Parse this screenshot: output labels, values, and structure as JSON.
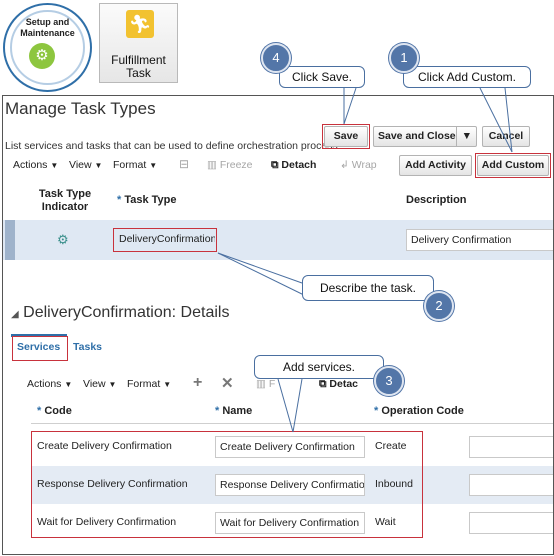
{
  "icons": {
    "setup": {
      "label_line1": "Setup and",
      "label_line2": "Maintenance",
      "icon": "gear-icon"
    },
    "fulfillment": {
      "label_line1": "Fulfillment",
      "label_line2": "Task",
      "icon": "runner-icon"
    }
  },
  "callouts": {
    "c1": {
      "number": "1",
      "text": "Click Add Custom."
    },
    "c2": {
      "number": "2",
      "text": "Describe the task."
    },
    "c3": {
      "number": "3",
      "text": "Add services."
    },
    "c4": {
      "number": "4",
      "text": "Click Save."
    }
  },
  "page": {
    "title": "Manage Task Types",
    "subtitle": "List services and tasks that can be used to define orchestration process"
  },
  "buttons": {
    "save": "Save",
    "save_and_close": "Save and Close",
    "cancel": "Cancel",
    "add_activity": "Add Activity",
    "add_custom": "Add Custom"
  },
  "toolbar": {
    "actions": "Actions",
    "view": "View",
    "format": "Format",
    "freeze": "Freeze",
    "detach": "Detach",
    "wrap": "Wrap"
  },
  "task_table": {
    "headers": {
      "indicator_line1": "Task Type",
      "indicator_line2": "Indicator",
      "task_type": "Task Type",
      "description": "Description"
    },
    "row": {
      "task_type": "DeliveryConfirmation",
      "description": "Delivery Confirmation"
    }
  },
  "details": {
    "title": "DeliveryConfirmation: Details",
    "tabs": [
      "Services",
      "Tasks"
    ],
    "toolbar": {
      "actions": "Actions",
      "view": "View",
      "format": "Format",
      "detach": "Detac"
    },
    "headers": {
      "code": "Code",
      "name": "Name",
      "operation_code": "Operation Code"
    },
    "rows": [
      {
        "code": "Create Delivery Confirmation",
        "name": "Create Delivery Confirmation",
        "operation_code": "Create"
      },
      {
        "code": "Response Delivery Confirmation",
        "name": "Response Delivery Confirmation",
        "operation_code": "Inbound"
      },
      {
        "code": "Wait for Delivery Confirmation",
        "name": "Wait for Delivery Confirmation",
        "operation_code": "Wait"
      }
    ]
  },
  "colors": {
    "accent": "#2f6fa8",
    "highlight_box": "#c8323c",
    "callout_number": "#5376a8",
    "selected_row": "#dfe8f3"
  }
}
